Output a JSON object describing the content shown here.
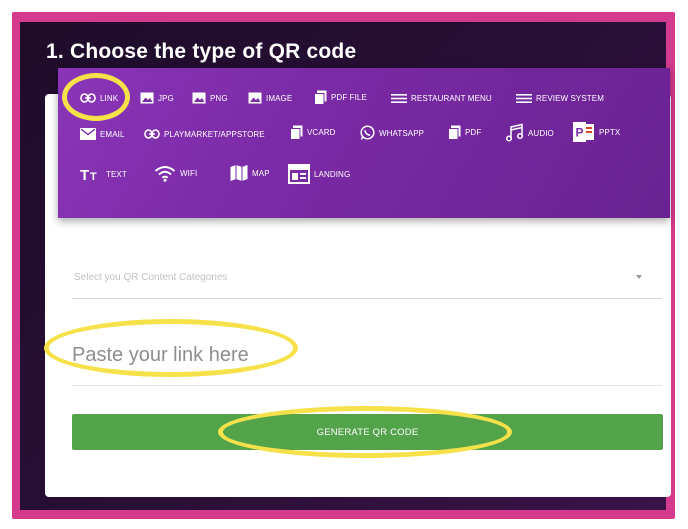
{
  "colors": {
    "frame": "#d43a8e",
    "panel": "#1e0c2a",
    "menu": "#7a2aa5",
    "button": "#53a34b",
    "highlight": "#f6e14a"
  },
  "page": {
    "heading": "1. Choose the type of QR code"
  },
  "qr_types": [
    {
      "label": "LINK",
      "icon": "link-icon"
    },
    {
      "label": "JPG",
      "icon": "image-icon"
    },
    {
      "label": "PNG",
      "icon": "image-icon"
    },
    {
      "label": "IMAGE",
      "icon": "image-icon"
    },
    {
      "label": "PDF FILE",
      "icon": "file-icon"
    },
    {
      "label": "RESTAURANT MENU",
      "icon": "menu-icon"
    },
    {
      "label": "REVIEW SYSTEM",
      "icon": "menu-icon"
    },
    {
      "label": "EMAIL",
      "icon": "mail-icon"
    },
    {
      "label": "PLAYMARKET/APPSTORE",
      "icon": "link-icon"
    },
    {
      "label": "VCARD",
      "icon": "file-icon"
    },
    {
      "label": "WHATSAPP",
      "icon": "whatsapp-icon"
    },
    {
      "label": "PDF",
      "icon": "file-icon"
    },
    {
      "label": "AUDIO",
      "icon": "music-icon"
    },
    {
      "label": "PPTX",
      "icon": "powerpoint-icon"
    },
    {
      "label": "TEXT",
      "icon": "text-icon"
    },
    {
      "label": "WIFI",
      "icon": "wifi-icon"
    },
    {
      "label": "MAP",
      "icon": "map-icon"
    },
    {
      "label": "LANDING",
      "icon": "landing-icon"
    }
  ],
  "form": {
    "category_placeholder": "Select you QR Content Categories",
    "link_placeholder": "Paste your link here",
    "generate_label": "GENERATE QR CODE"
  }
}
